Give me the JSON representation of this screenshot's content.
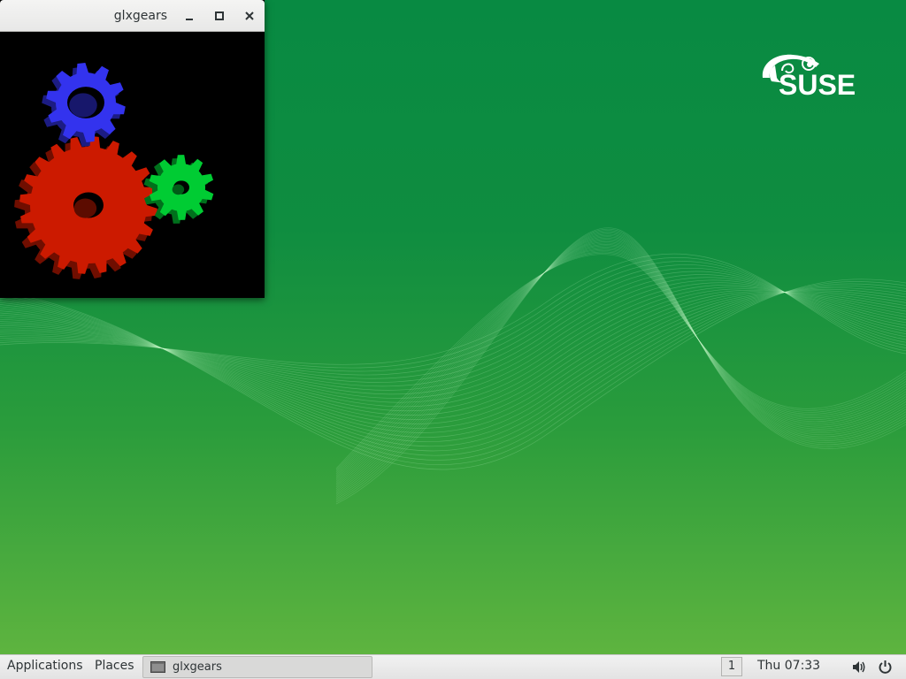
{
  "window": {
    "title": "glxgears",
    "gear_colors": [
      "#cc1a00",
      "#00cc33",
      "#3333ee"
    ],
    "controls": [
      "minimize-icon",
      "maximize-icon",
      "close-icon"
    ]
  },
  "desktop": {
    "logo_text": "SUSE",
    "background_top": "#088a42",
    "background_bottom": "#5eb43f"
  },
  "panel": {
    "applications_label": "Applications",
    "places_label": "Places",
    "task_label": "glxgears",
    "workspace_number": "1",
    "clock": "Thu 07:33",
    "icons": [
      "volume-icon",
      "power-icon"
    ]
  }
}
